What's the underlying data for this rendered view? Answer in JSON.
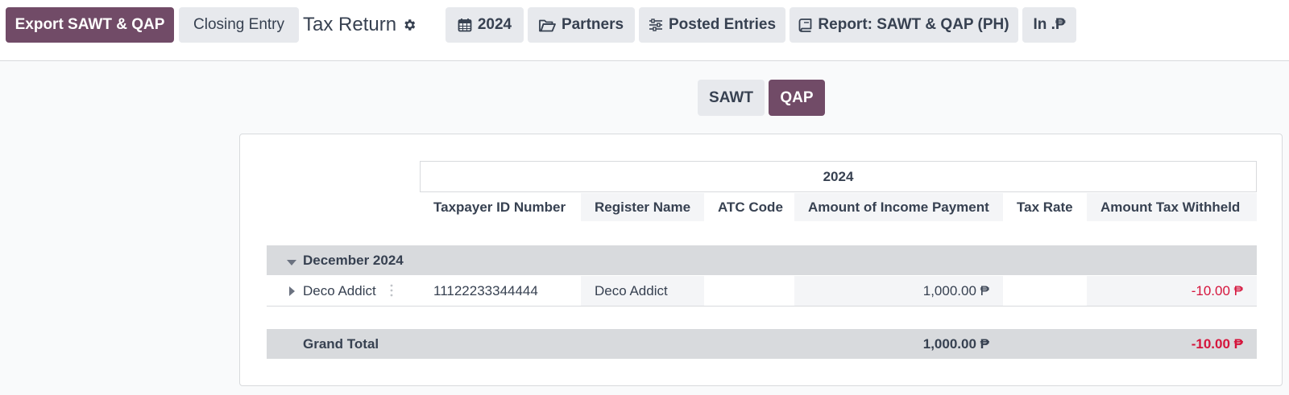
{
  "control_panel": {
    "export_button": "Export SAWT & QAP",
    "closing_entry_button": "Closing Entry",
    "breadcrumb_title": "Tax Return",
    "filters": {
      "date": "2024",
      "partners": "Partners",
      "posted_entries": "Posted Entries",
      "report": "Report: SAWT & QAP (PH)",
      "currency": "In .₱"
    }
  },
  "report_toggle": {
    "sawt_label": "SAWT",
    "qap_label": "QAP",
    "active": "QAP"
  },
  "table": {
    "period_header": "2024",
    "columns": [
      "Taxpayer ID Number",
      "Register Name",
      "ATC Code",
      "Amount of Income Payment",
      "Tax Rate",
      "Amount Tax Withheld"
    ],
    "groups": [
      {
        "label": "December 2024",
        "rows": [
          {
            "label": "Deco Addict",
            "taxpayer_id": "11122233344444",
            "register_name": "Deco Addict",
            "atc_code": "",
            "income_payment": "1,000.00 ₱",
            "tax_rate": "",
            "tax_withheld": "-10.00 ₱"
          }
        ]
      }
    ],
    "grand_total": {
      "label": "Grand Total",
      "income_payment": "1,000.00 ₱",
      "tax_withheld": "-10.00 ₱"
    }
  },
  "colors": {
    "primary": "#714b67",
    "negative": "#d5153c",
    "band": "#d8dadd"
  }
}
